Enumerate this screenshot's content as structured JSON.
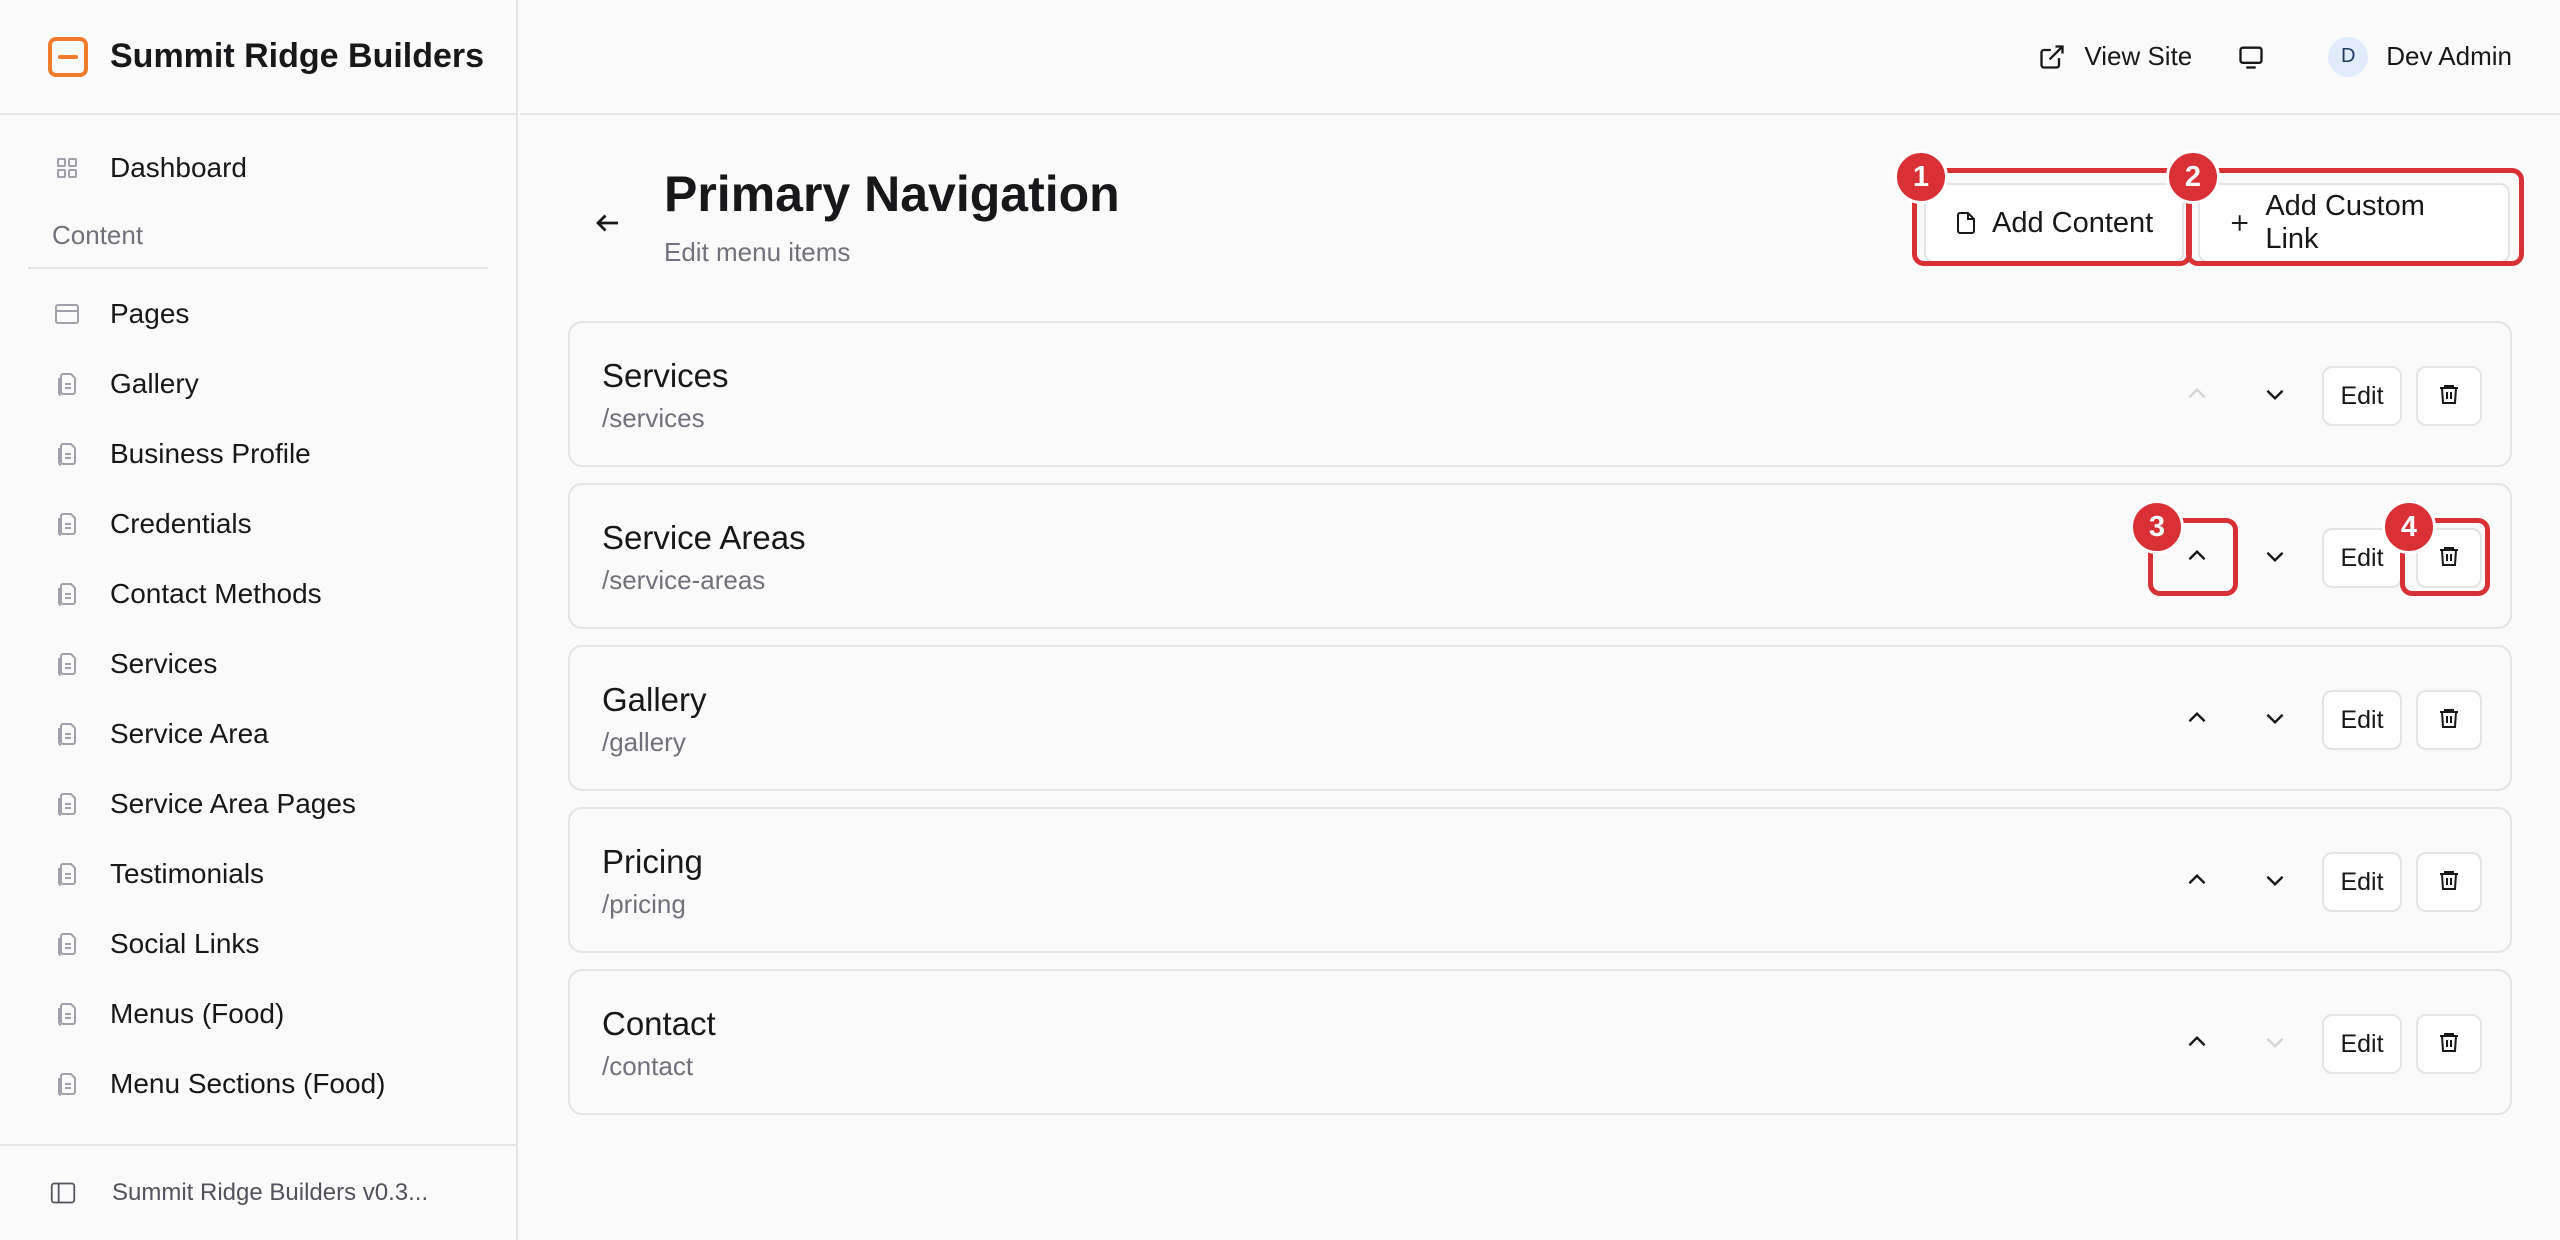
{
  "brand": {
    "name": "Summit Ridge Builders"
  },
  "sidebar": {
    "top_item": {
      "label": "Dashboard",
      "icon": "dashboard-grid-icon"
    },
    "section_label": "Content",
    "items": [
      {
        "label": "Pages",
        "icon": "window-icon"
      },
      {
        "label": "Gallery",
        "icon": "document-stack-icon"
      },
      {
        "label": "Business Profile",
        "icon": "document-stack-icon"
      },
      {
        "label": "Credentials",
        "icon": "document-stack-icon"
      },
      {
        "label": "Contact Methods",
        "icon": "document-stack-icon"
      },
      {
        "label": "Services",
        "icon": "document-stack-icon"
      },
      {
        "label": "Service Area",
        "icon": "document-stack-icon"
      },
      {
        "label": "Service Area Pages",
        "icon": "document-stack-icon"
      },
      {
        "label": "Testimonials",
        "icon": "document-stack-icon"
      },
      {
        "label": "Social Links",
        "icon": "document-stack-icon"
      },
      {
        "label": "Menus (Food)",
        "icon": "document-stack-icon"
      },
      {
        "label": "Menu Sections (Food)",
        "icon": "document-stack-icon"
      }
    ],
    "footer_label": "Summit Ridge Builders v0.3..."
  },
  "topbar": {
    "view_site": "View Site",
    "user_initial": "D",
    "user_name": "Dev Admin"
  },
  "page": {
    "title": "Primary Navigation",
    "subtitle": "Edit menu items",
    "add_content_label": "Add Content",
    "add_custom_link_label": "Add Custom Link"
  },
  "menu_items": [
    {
      "title": "Services",
      "path": "/services",
      "edit_label": "Edit",
      "up_disabled": true,
      "down_disabled": false
    },
    {
      "title": "Service Areas",
      "path": "/service-areas",
      "edit_label": "Edit",
      "up_disabled": false,
      "down_disabled": false
    },
    {
      "title": "Gallery",
      "path": "/gallery",
      "edit_label": "Edit",
      "up_disabled": false,
      "down_disabled": false
    },
    {
      "title": "Pricing",
      "path": "/pricing",
      "edit_label": "Edit",
      "up_disabled": false,
      "down_disabled": false
    },
    {
      "title": "Contact",
      "path": "/contact",
      "edit_label": "Edit",
      "up_disabled": false,
      "down_disabled": true
    }
  ],
  "annotations": [
    "1",
    "2",
    "3",
    "4"
  ],
  "colors": {
    "accent": "#f07b2a",
    "annotation": "#d93036",
    "border": "#e4e4e7",
    "muted": "#71717a"
  }
}
